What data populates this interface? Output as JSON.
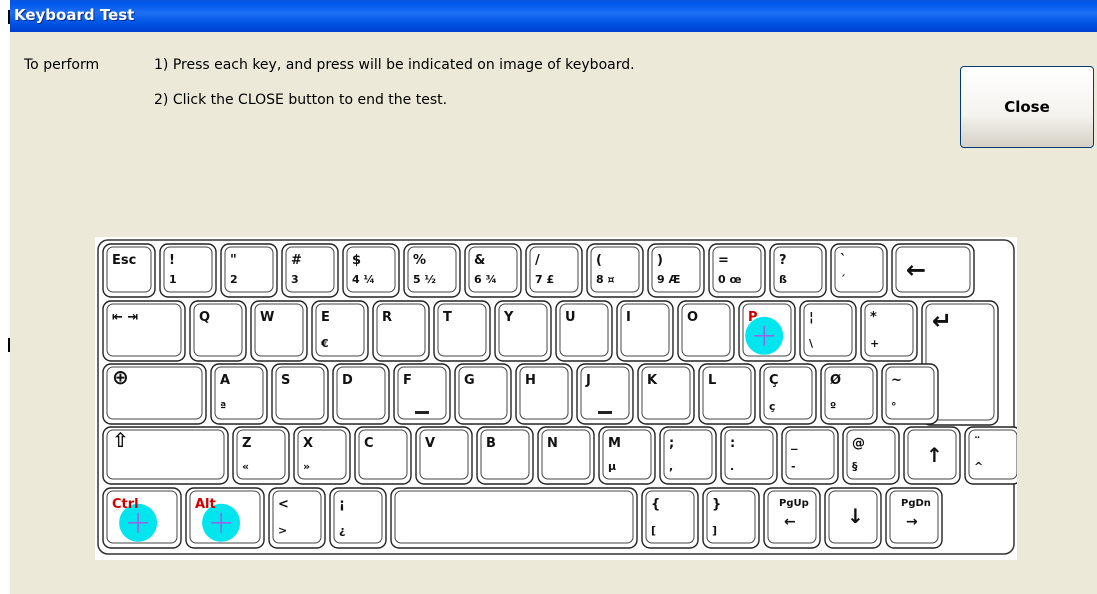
{
  "window": {
    "title": "Keyboard Test"
  },
  "instructions": {
    "label": "To perform",
    "step1": "1) Press each key, and press will be indicated on image of keyboard.",
    "step2": "2) Click the CLOSE button to end the test."
  },
  "close_button": {
    "label": "Close"
  },
  "keyboard": {
    "pressed_marker_color": "#00e5ee",
    "rows": [
      [
        {
          "k": "esc",
          "top": "Esc",
          "bottom": ""
        },
        {
          "k": "1",
          "top": "!",
          "bottom": "1"
        },
        {
          "k": "2",
          "top": "\"",
          "bottom": "2"
        },
        {
          "k": "3",
          "top": "#",
          "bottom": "3"
        },
        {
          "k": "4",
          "top": "$",
          "bottom": "4 ¼"
        },
        {
          "k": "5",
          "top": "%",
          "bottom": "5 ½"
        },
        {
          "k": "6",
          "top": "&",
          "bottom": "6 ¾"
        },
        {
          "k": "7",
          "top": "/",
          "bottom": "7 £"
        },
        {
          "k": "8",
          "top": "(",
          "bottom": "8 ¤"
        },
        {
          "k": "9",
          "top": ")",
          "bottom": "9 Æ"
        },
        {
          "k": "0",
          "top": "=",
          "bottom": "0 œ"
        },
        {
          "k": "sz",
          "top": "?",
          "bottom": "ß"
        },
        {
          "k": "acute",
          "top": "`",
          "bottom": "´"
        },
        {
          "k": "backspace",
          "top": "←",
          "bottom": ""
        }
      ],
      [
        {
          "k": "tab",
          "top": "⇤ ⇥",
          "bottom": ""
        },
        {
          "k": "q",
          "top": "Q",
          "bottom": ""
        },
        {
          "k": "w",
          "top": "W",
          "bottom": ""
        },
        {
          "k": "e",
          "top": "E",
          "bottom": "€"
        },
        {
          "k": "r",
          "top": "R",
          "bottom": ""
        },
        {
          "k": "t",
          "top": "T",
          "bottom": ""
        },
        {
          "k": "y",
          "top": "Y",
          "bottom": ""
        },
        {
          "k": "u",
          "top": "U",
          "bottom": ""
        },
        {
          "k": "i",
          "top": "I",
          "bottom": ""
        },
        {
          "k": "o",
          "top": "O",
          "bottom": ""
        },
        {
          "k": "p",
          "top": "P",
          "bottom": "",
          "pressed": true
        },
        {
          "k": "backslash",
          "top": "¦",
          "bottom": "\\"
        },
        {
          "k": "star",
          "top": "*",
          "bottom": "+"
        },
        {
          "k": "enter",
          "top": "↵",
          "bottom": ""
        }
      ],
      [
        {
          "k": "caps",
          "top": "⊕",
          "bottom": ""
        },
        {
          "k": "a",
          "top": "A",
          "bottom": "ª"
        },
        {
          "k": "s",
          "top": "S",
          "bottom": ""
        },
        {
          "k": "d",
          "top": "D",
          "bottom": ""
        },
        {
          "k": "f",
          "top": "F",
          "bottom": ""
        },
        {
          "k": "g",
          "top": "G",
          "bottom": ""
        },
        {
          "k": "h",
          "top": "H",
          "bottom": ""
        },
        {
          "k": "j",
          "top": "J",
          "bottom": ""
        },
        {
          "k": "k",
          "top": "K",
          "bottom": ""
        },
        {
          "k": "l",
          "top": "L",
          "bottom": ""
        },
        {
          "k": "ccedil",
          "top": "Ç",
          "bottom": "ç"
        },
        {
          "k": "oslash",
          "top": "Ø",
          "bottom": "º"
        },
        {
          "k": "tilde",
          "top": "~",
          "bottom": "°"
        }
      ],
      [
        {
          "k": "lshift",
          "top": "⇧",
          "bottom": ""
        },
        {
          "k": "z",
          "top": "Z",
          "bottom": "«"
        },
        {
          "k": "x",
          "top": "X",
          "bottom": "»"
        },
        {
          "k": "c",
          "top": "C",
          "bottom": ""
        },
        {
          "k": "v",
          "top": "V",
          "bottom": ""
        },
        {
          "k": "b",
          "top": "B",
          "bottom": ""
        },
        {
          "k": "n",
          "top": "N",
          "bottom": ""
        },
        {
          "k": "m",
          "top": "M",
          "bottom": "µ"
        },
        {
          "k": "semicolon",
          "top": ";",
          "bottom": ","
        },
        {
          "k": "colon",
          "top": ":",
          "bottom": "."
        },
        {
          "k": "dash",
          "top": "_",
          "bottom": "-"
        },
        {
          "k": "at",
          "top": "@",
          "bottom": "§"
        },
        {
          "k": "up",
          "top": "↑",
          "bottom": ""
        },
        {
          "k": "caret",
          "top": "¨",
          "bottom": "^"
        }
      ],
      [
        {
          "k": "ctrl",
          "top": "Ctrl",
          "bottom": "",
          "pressed": true
        },
        {
          "k": "alt",
          "top": "Alt",
          "bottom": "",
          "pressed": true
        },
        {
          "k": "lt",
          "top": "<",
          "bottom": ">"
        },
        {
          "k": "excl",
          "top": "¡",
          "bottom": "¿"
        },
        {
          "k": "space",
          "top": "",
          "bottom": ""
        },
        {
          "k": "lbrace",
          "top": "{",
          "bottom": "["
        },
        {
          "k": "rbrace",
          "top": "}",
          "bottom": "]"
        },
        {
          "k": "pgup",
          "top": "PgUp",
          "bottom": "←"
        },
        {
          "k": "down",
          "top": "↓",
          "bottom": ""
        },
        {
          "k": "pgdn",
          "top": "PgDn",
          "bottom": "→"
        }
      ]
    ]
  }
}
